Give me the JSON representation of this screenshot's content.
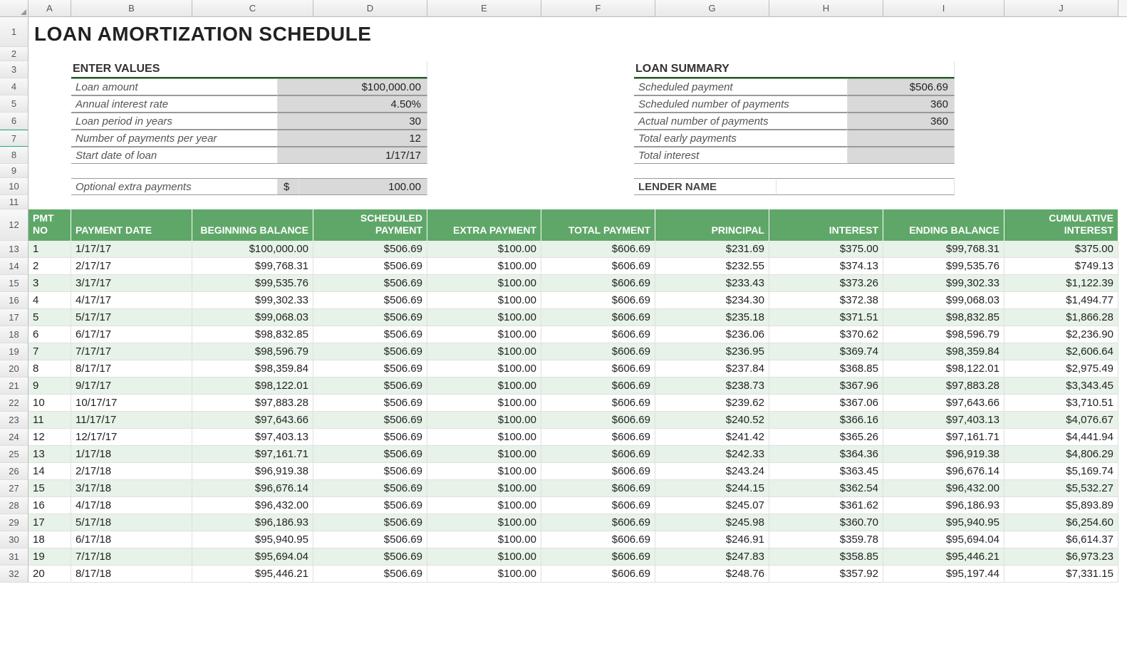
{
  "title": "LOAN AMORTIZATION SCHEDULE",
  "columns": [
    "A",
    "B",
    "C",
    "D",
    "E",
    "F",
    "G",
    "H",
    "I",
    "J"
  ],
  "row_numbers": [
    1,
    2,
    3,
    4,
    5,
    6,
    7,
    8,
    9,
    10,
    11,
    12,
    13,
    14,
    15,
    16,
    17,
    18,
    19,
    20,
    21,
    22,
    23,
    24,
    25,
    26,
    27,
    28,
    29,
    30,
    31,
    32
  ],
  "enter_values": {
    "header": "ENTER VALUES",
    "rows": [
      {
        "label": "Loan amount",
        "value": "$100,000.00"
      },
      {
        "label": "Annual interest rate",
        "value": "4.50%"
      },
      {
        "label": "Loan period in years",
        "value": "30"
      },
      {
        "label": "Number of payments per year",
        "value": "12"
      },
      {
        "label": "Start date of loan",
        "value": "1/17/17"
      }
    ],
    "extra_label": "Optional extra payments",
    "extra_prefix": "$",
    "extra_value": "100.00"
  },
  "loan_summary": {
    "header": "LOAN SUMMARY",
    "rows": [
      {
        "label": "Scheduled payment",
        "value": "$506.69"
      },
      {
        "label": "Scheduled number of payments",
        "value": "360"
      },
      {
        "label": "Actual number of payments",
        "value": "360"
      },
      {
        "label": "Total early payments",
        "value": ""
      },
      {
        "label": "Total interest",
        "value": ""
      }
    ],
    "lender_label": "LENDER NAME"
  },
  "table_headers": {
    "pmt_no": "PMT NO",
    "payment_date": "PAYMENT DATE",
    "beginning_balance": "BEGINNING BALANCE",
    "scheduled_payment": "SCHEDULED PAYMENT",
    "extra_payment": "EXTRA PAYMENT",
    "total_payment": "TOTAL PAYMENT",
    "principal": "PRINCIPAL",
    "interest": "INTEREST",
    "ending_balance": "ENDING BALANCE",
    "cumulative_interest": "CUMULATIVE INTEREST"
  },
  "rows": [
    {
      "no": "1",
      "date": "1/17/17",
      "bb": "$100,000.00",
      "sp": "$506.69",
      "ep": "$100.00",
      "tp": "$606.69",
      "pr": "$231.69",
      "int": "$375.00",
      "eb": "$99,768.31",
      "ci": "$375.00"
    },
    {
      "no": "2",
      "date": "2/17/17",
      "bb": "$99,768.31",
      "sp": "$506.69",
      "ep": "$100.00",
      "tp": "$606.69",
      "pr": "$232.55",
      "int": "$374.13",
      "eb": "$99,535.76",
      "ci": "$749.13"
    },
    {
      "no": "3",
      "date": "3/17/17",
      "bb": "$99,535.76",
      "sp": "$506.69",
      "ep": "$100.00",
      "tp": "$606.69",
      "pr": "$233.43",
      "int": "$373.26",
      "eb": "$99,302.33",
      "ci": "$1,122.39"
    },
    {
      "no": "4",
      "date": "4/17/17",
      "bb": "$99,302.33",
      "sp": "$506.69",
      "ep": "$100.00",
      "tp": "$606.69",
      "pr": "$234.30",
      "int": "$372.38",
      "eb": "$99,068.03",
      "ci": "$1,494.77"
    },
    {
      "no": "5",
      "date": "5/17/17",
      "bb": "$99,068.03",
      "sp": "$506.69",
      "ep": "$100.00",
      "tp": "$606.69",
      "pr": "$235.18",
      "int": "$371.51",
      "eb": "$98,832.85",
      "ci": "$1,866.28"
    },
    {
      "no": "6",
      "date": "6/17/17",
      "bb": "$98,832.85",
      "sp": "$506.69",
      "ep": "$100.00",
      "tp": "$606.69",
      "pr": "$236.06",
      "int": "$370.62",
      "eb": "$98,596.79",
      "ci": "$2,236.90"
    },
    {
      "no": "7",
      "date": "7/17/17",
      "bb": "$98,596.79",
      "sp": "$506.69",
      "ep": "$100.00",
      "tp": "$606.69",
      "pr": "$236.95",
      "int": "$369.74",
      "eb": "$98,359.84",
      "ci": "$2,606.64"
    },
    {
      "no": "8",
      "date": "8/17/17",
      "bb": "$98,359.84",
      "sp": "$506.69",
      "ep": "$100.00",
      "tp": "$606.69",
      "pr": "$237.84",
      "int": "$368.85",
      "eb": "$98,122.01",
      "ci": "$2,975.49"
    },
    {
      "no": "9",
      "date": "9/17/17",
      "bb": "$98,122.01",
      "sp": "$506.69",
      "ep": "$100.00",
      "tp": "$606.69",
      "pr": "$238.73",
      "int": "$367.96",
      "eb": "$97,883.28",
      "ci": "$3,343.45"
    },
    {
      "no": "10",
      "date": "10/17/17",
      "bb": "$97,883.28",
      "sp": "$506.69",
      "ep": "$100.00",
      "tp": "$606.69",
      "pr": "$239.62",
      "int": "$367.06",
      "eb": "$97,643.66",
      "ci": "$3,710.51"
    },
    {
      "no": "11",
      "date": "11/17/17",
      "bb": "$97,643.66",
      "sp": "$506.69",
      "ep": "$100.00",
      "tp": "$606.69",
      "pr": "$240.52",
      "int": "$366.16",
      "eb": "$97,403.13",
      "ci": "$4,076.67"
    },
    {
      "no": "12",
      "date": "12/17/17",
      "bb": "$97,403.13",
      "sp": "$506.69",
      "ep": "$100.00",
      "tp": "$606.69",
      "pr": "$241.42",
      "int": "$365.26",
      "eb": "$97,161.71",
      "ci": "$4,441.94"
    },
    {
      "no": "13",
      "date": "1/17/18",
      "bb": "$97,161.71",
      "sp": "$506.69",
      "ep": "$100.00",
      "tp": "$606.69",
      "pr": "$242.33",
      "int": "$364.36",
      "eb": "$96,919.38",
      "ci": "$4,806.29"
    },
    {
      "no": "14",
      "date": "2/17/18",
      "bb": "$96,919.38",
      "sp": "$506.69",
      "ep": "$100.00",
      "tp": "$606.69",
      "pr": "$243.24",
      "int": "$363.45",
      "eb": "$96,676.14",
      "ci": "$5,169.74"
    },
    {
      "no": "15",
      "date": "3/17/18",
      "bb": "$96,676.14",
      "sp": "$506.69",
      "ep": "$100.00",
      "tp": "$606.69",
      "pr": "$244.15",
      "int": "$362.54",
      "eb": "$96,432.00",
      "ci": "$5,532.27"
    },
    {
      "no": "16",
      "date": "4/17/18",
      "bb": "$96,432.00",
      "sp": "$506.69",
      "ep": "$100.00",
      "tp": "$606.69",
      "pr": "$245.07",
      "int": "$361.62",
      "eb": "$96,186.93",
      "ci": "$5,893.89"
    },
    {
      "no": "17",
      "date": "5/17/18",
      "bb": "$96,186.93",
      "sp": "$506.69",
      "ep": "$100.00",
      "tp": "$606.69",
      "pr": "$245.98",
      "int": "$360.70",
      "eb": "$95,940.95",
      "ci": "$6,254.60"
    },
    {
      "no": "18",
      "date": "6/17/18",
      "bb": "$95,940.95",
      "sp": "$506.69",
      "ep": "$100.00",
      "tp": "$606.69",
      "pr": "$246.91",
      "int": "$359.78",
      "eb": "$95,694.04",
      "ci": "$6,614.37"
    },
    {
      "no": "19",
      "date": "7/17/18",
      "bb": "$95,694.04",
      "sp": "$506.69",
      "ep": "$100.00",
      "tp": "$606.69",
      "pr": "$247.83",
      "int": "$358.85",
      "eb": "$95,446.21",
      "ci": "$6,973.23"
    },
    {
      "no": "20",
      "date": "8/17/18",
      "bb": "$95,446.21",
      "sp": "$506.69",
      "ep": "$100.00",
      "tp": "$606.69",
      "pr": "$248.76",
      "int": "$357.92",
      "eb": "$95,197.44",
      "ci": "$7,331.15"
    }
  ]
}
